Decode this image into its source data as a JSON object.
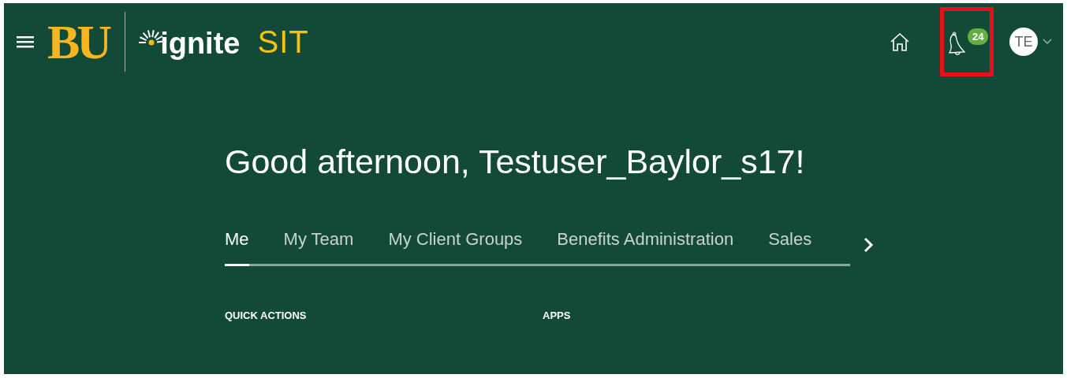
{
  "header": {
    "logo_mark": "BU",
    "app_name": "ignite",
    "environment": "SIT",
    "notifications": {
      "count": "24",
      "highlighted": true
    },
    "avatar": {
      "initials": "TE"
    }
  },
  "greeting": "Good afternoon, Testuser_Baylor_s17!",
  "tabs": [
    {
      "label": "Me",
      "selected": true
    },
    {
      "label": "My Team",
      "selected": false
    },
    {
      "label": "My Client Groups",
      "selected": false
    },
    {
      "label": "Benefits Administration",
      "selected": false
    },
    {
      "label": "Sales",
      "selected": false
    }
  ],
  "sections": [
    "QUICK ACTIONS",
    "APPS"
  ]
}
